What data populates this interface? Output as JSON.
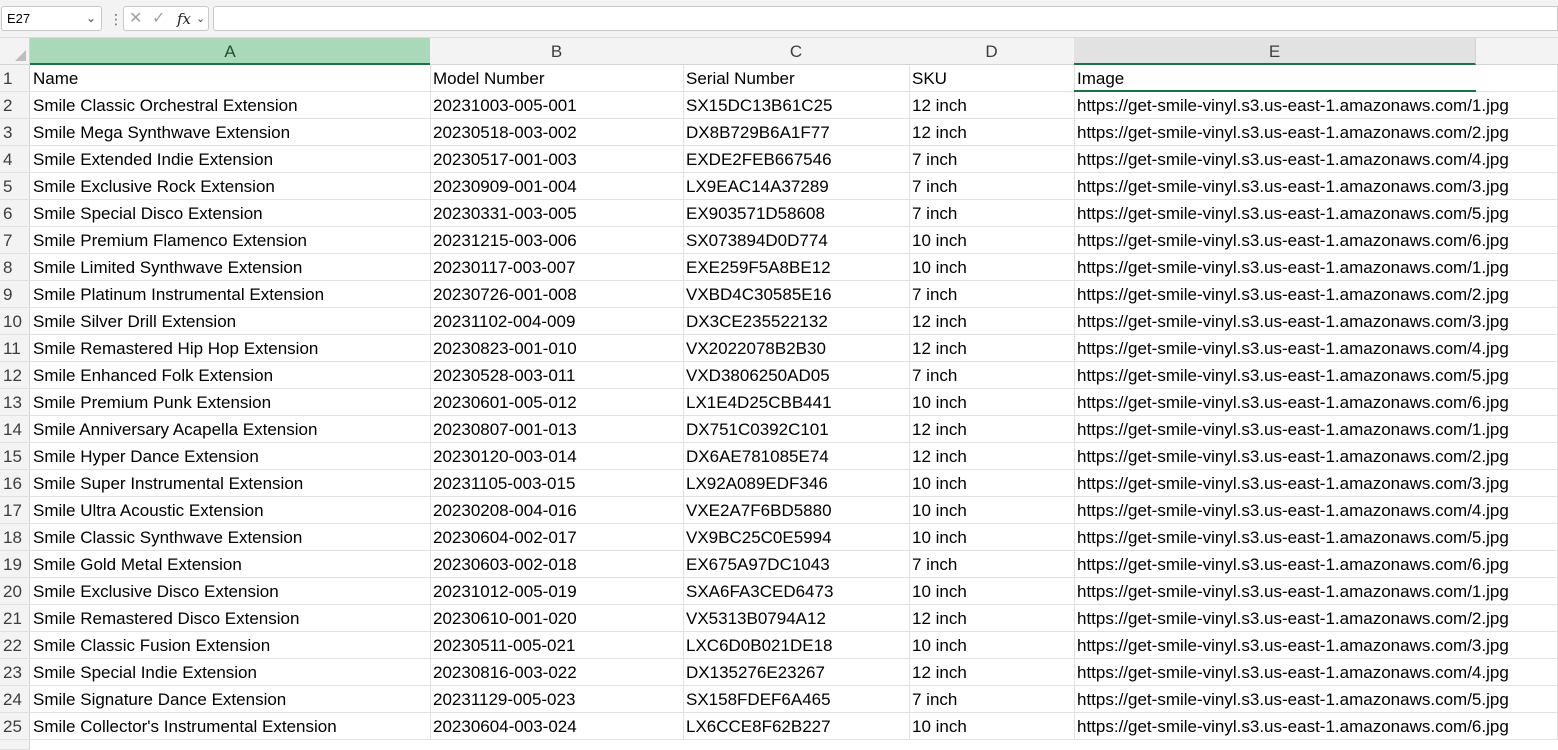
{
  "formula_bar": {
    "name_box": "E27",
    "formula": ""
  },
  "columns": [
    "A",
    "B",
    "C",
    "D",
    "E"
  ],
  "rows": [
    {
      "num": "1",
      "cells": [
        "Name",
        "Model Number",
        "Serial Number",
        "SKU",
        "Image"
      ]
    },
    {
      "num": "2",
      "cells": [
        "Smile Classic Orchestral Extension",
        "20231003-005-001",
        "SX15DC13B61C25",
        "12 inch",
        "https://get-smile-vinyl.s3.us-east-1.amazonaws.com/1.jpg"
      ]
    },
    {
      "num": "3",
      "cells": [
        "Smile Mega Synthwave Extension",
        "20230518-003-002",
        "DX8B729B6A1F77",
        "12 inch",
        "https://get-smile-vinyl.s3.us-east-1.amazonaws.com/2.jpg"
      ]
    },
    {
      "num": "4",
      "cells": [
        "Smile Extended Indie Extension",
        "20230517-001-003",
        "EXDE2FEB667546",
        "7 inch",
        "https://get-smile-vinyl.s3.us-east-1.amazonaws.com/4.jpg"
      ]
    },
    {
      "num": "5",
      "cells": [
        "Smile Exclusive Rock Extension",
        "20230909-001-004",
        "LX9EAC14A37289",
        "7 inch",
        "https://get-smile-vinyl.s3.us-east-1.amazonaws.com/3.jpg"
      ]
    },
    {
      "num": "6",
      "cells": [
        "Smile Special Disco Extension",
        "20230331-003-005",
        "EX903571D58608",
        "7 inch",
        "https://get-smile-vinyl.s3.us-east-1.amazonaws.com/5.jpg"
      ]
    },
    {
      "num": "7",
      "cells": [
        "Smile Premium Flamenco Extension",
        "20231215-003-006",
        "SX073894D0D774",
        "10 inch",
        "https://get-smile-vinyl.s3.us-east-1.amazonaws.com/6.jpg"
      ]
    },
    {
      "num": "8",
      "cells": [
        "Smile Limited Synthwave Extension",
        "20230117-003-007",
        "EXE259F5A8BE12",
        "10 inch",
        "https://get-smile-vinyl.s3.us-east-1.amazonaws.com/1.jpg"
      ]
    },
    {
      "num": "9",
      "cells": [
        "Smile Platinum Instrumental Extension",
        "20230726-001-008",
        "VXBD4C30585E16",
        "7 inch",
        "https://get-smile-vinyl.s3.us-east-1.amazonaws.com/2.jpg"
      ]
    },
    {
      "num": "10",
      "cells": [
        "Smile Silver Drill Extension",
        "20231102-004-009",
        "DX3CE235522132",
        "12 inch",
        "https://get-smile-vinyl.s3.us-east-1.amazonaws.com/3.jpg"
      ]
    },
    {
      "num": "11",
      "cells": [
        "Smile Remastered Hip Hop Extension",
        "20230823-001-010",
        "VX2022078B2B30",
        "12 inch",
        "https://get-smile-vinyl.s3.us-east-1.amazonaws.com/4.jpg"
      ]
    },
    {
      "num": "12",
      "cells": [
        "Smile Enhanced Folk Extension",
        "20230528-003-011",
        "VXD3806250AD05",
        "7 inch",
        "https://get-smile-vinyl.s3.us-east-1.amazonaws.com/5.jpg"
      ]
    },
    {
      "num": "13",
      "cells": [
        "Smile Premium Punk Extension",
        "20230601-005-012",
        "LX1E4D25CBB441",
        "10 inch",
        "https://get-smile-vinyl.s3.us-east-1.amazonaws.com/6.jpg"
      ]
    },
    {
      "num": "14",
      "cells": [
        "Smile Anniversary Acapella Extension",
        "20230807-001-013",
        "DX751C0392C101",
        "12 inch",
        "https://get-smile-vinyl.s3.us-east-1.amazonaws.com/1.jpg"
      ]
    },
    {
      "num": "15",
      "cells": [
        "Smile Hyper Dance Extension",
        "20230120-003-014",
        "DX6AE781085E74",
        "12 inch",
        "https://get-smile-vinyl.s3.us-east-1.amazonaws.com/2.jpg"
      ]
    },
    {
      "num": "16",
      "cells": [
        "Smile Super Instrumental Extension",
        "20231105-003-015",
        "LX92A089EDF346",
        "10 inch",
        "https://get-smile-vinyl.s3.us-east-1.amazonaws.com/3.jpg"
      ]
    },
    {
      "num": "17",
      "cells": [
        "Smile Ultra Acoustic Extension",
        "20230208-004-016",
        "VXE2A7F6BD5880",
        "10 inch",
        "https://get-smile-vinyl.s3.us-east-1.amazonaws.com/4.jpg"
      ]
    },
    {
      "num": "18",
      "cells": [
        "Smile Classic Synthwave Extension",
        "20230604-002-017",
        "VX9BC25C0E5994",
        "10 inch",
        "https://get-smile-vinyl.s3.us-east-1.amazonaws.com/5.jpg"
      ]
    },
    {
      "num": "19",
      "cells": [
        "Smile Gold Metal Extension",
        "20230603-002-018",
        "EX675A97DC1043",
        "7 inch",
        "https://get-smile-vinyl.s3.us-east-1.amazonaws.com/6.jpg"
      ]
    },
    {
      "num": "20",
      "cells": [
        "Smile Exclusive Disco Extension",
        "20231012-005-019",
        "SXA6FA3CED6473",
        "10 inch",
        "https://get-smile-vinyl.s3.us-east-1.amazonaws.com/1.jpg"
      ]
    },
    {
      "num": "21",
      "cells": [
        "Smile Remastered Disco Extension",
        "20230610-001-020",
        "VX5313B0794A12",
        "12 inch",
        "https://get-smile-vinyl.s3.us-east-1.amazonaws.com/2.jpg"
      ]
    },
    {
      "num": "22",
      "cells": [
        "Smile Classic Fusion Extension",
        "20230511-005-021",
        "LXC6D0B021DE18",
        "10 inch",
        "https://get-smile-vinyl.s3.us-east-1.amazonaws.com/3.jpg"
      ]
    },
    {
      "num": "23",
      "cells": [
        "Smile Special Indie Extension",
        "20230816-003-022",
        "DX135276E23267",
        "12 inch",
        "https://get-smile-vinyl.s3.us-east-1.amazonaws.com/4.jpg"
      ]
    },
    {
      "num": "24",
      "cells": [
        "Smile Signature Dance Extension",
        "20231129-005-023",
        "SX158FDEF6A465",
        "7 inch",
        "https://get-smile-vinyl.s3.us-east-1.amazonaws.com/5.jpg"
      ]
    },
    {
      "num": "25",
      "cells": [
        "Smile Collector's Instrumental Extension",
        "20230604-003-024",
        "LX6CCE8F62B227",
        "10 inch",
        "https://get-smile-vinyl.s3.us-east-1.amazonaws.com/6.jpg"
      ]
    }
  ]
}
